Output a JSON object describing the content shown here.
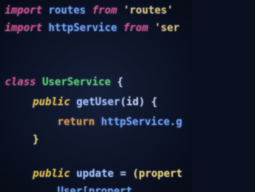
{
  "code": {
    "line1": {
      "keyword": "import",
      "name": "routes",
      "from": "from",
      "module": "'routes'"
    },
    "line2": {
      "keyword": "import",
      "name": "httpService",
      "from": "from",
      "module": "'ser"
    },
    "line3": {
      "keyword": "class",
      "name": "UserService",
      "brace": "{"
    },
    "line4": {
      "modifier": "public",
      "method": "getUser",
      "params": "(id)",
      "brace": "{"
    },
    "line5": {
      "keyword": "return",
      "expr": "httpService.g"
    },
    "line6": {
      "brace": "}"
    },
    "line7": {
      "modifier": "public",
      "method": "update",
      "op": "=",
      "params": "(propert"
    },
    "line8": {
      "expr": "User[propert"
    }
  },
  "colors": {
    "background": "#0c1326",
    "keyword_pink": "#e0508a",
    "keyword_gold": "#f0c23a",
    "identifier_blue": "#72a8ff",
    "class_green": "#5ad66a",
    "string": "#e8c874"
  }
}
